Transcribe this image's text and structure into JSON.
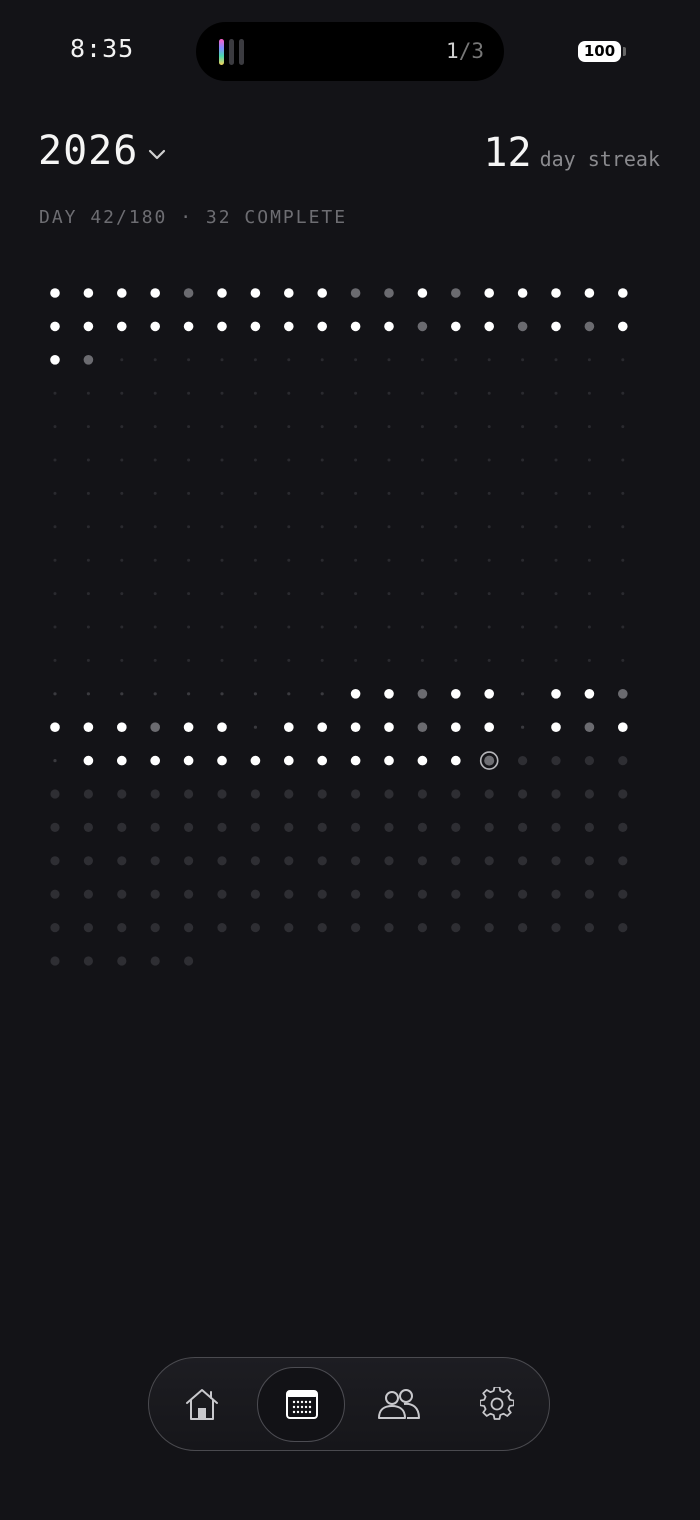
{
  "status_bar": {
    "time": "8:35",
    "activity_index": "1",
    "activity_total": "/3",
    "battery": "100"
  },
  "header": {
    "year": "2026",
    "streak_count": "12",
    "streak_label": "day streak",
    "day_info": "DAY 42/180 · 32 COMPLETE"
  },
  "grid": {
    "columns": 18,
    "legend_states": {
      "C": "complete",
      "P": "partial",
      "M": "missed",
      "T": "today",
      "F": "future",
      "E": "empty"
    },
    "rows": [
      "CCCCPCCCCPPCPCCCCC",
      "CCCCCCCCCCCPCCPCPC",
      "CPEEEEEEEEEEEEEEEE",
      "EEEEEEEEEEEEEEEEEE",
      "EEEEEEEEEEEEEEEEEE",
      "EEEEEEEEEEEEEEEEEE",
      "EEEEEEEEEEEEEEEEEE",
      "EEEEEEEEEEEEEEEEEE",
      "EEEEEEEEEEEEEEEEEE",
      "EEEEEEEEEEEEEEEEEE",
      "EEEEEEEEEEEEEEEEEE",
      "EEEEEEEEEEEEEEEEEE",
      "MMMMMMMMMCCPCCMCCPC",
      "CCCPCCMCCCCPCCMCPC",
      "MCCCCCCCCCCCCTFFFF",
      "FFFFFFFFFFFFFFFFFF",
      "FFFFFFFFFFFFFFFFFF",
      "FFFFFFFFFFFFFFFFFF",
      "FFFFFFFFFFFFFFFFFF",
      "FFFFFFFFFFFFFFFFFF",
      "FFFFF"
    ]
  },
  "colors": {
    "background": "#131317",
    "complete": "#ffffff",
    "partial": "#6b6b70",
    "future": "#2e2e33",
    "empty": "#2a2a2f",
    "today_ring": "#b5b5b9"
  },
  "tabbar": {
    "items": [
      {
        "name": "home",
        "icon": "house-icon",
        "active": false
      },
      {
        "name": "calendar",
        "icon": "calendar-icon",
        "active": true
      },
      {
        "name": "friends",
        "icon": "people-icon",
        "active": false
      },
      {
        "name": "settings",
        "icon": "gear-icon",
        "active": false
      }
    ]
  }
}
